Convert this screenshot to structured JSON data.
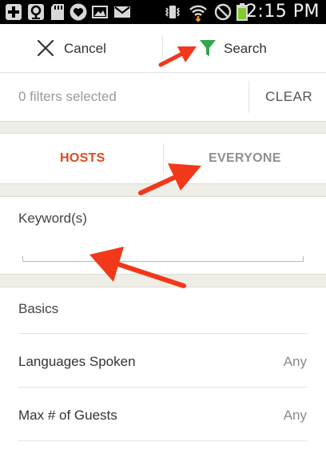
{
  "status_bar": {
    "time": "2:15 PM",
    "left_icons": [
      "plus-icon",
      "location-pin-icon",
      "sd-card-icon",
      "heart-icon",
      "image-icon",
      "gmail-icon"
    ],
    "right_icons": [
      "vibrate-icon",
      "wifi-icon",
      "no-signal-icon",
      "battery-icon"
    ]
  },
  "action_bar": {
    "cancel_label": "Cancel",
    "search_label": "Search",
    "cancel_icon": "close-icon",
    "search_icon": "filter-funnel-icon"
  },
  "filter_bar": {
    "count_text": "0 filters selected",
    "clear_label": "CLEAR"
  },
  "tabs": [
    {
      "label": "HOSTS",
      "active": true
    },
    {
      "label": "EVERYONE",
      "active": false
    }
  ],
  "keyword": {
    "label": "Keyword(s)",
    "value": ""
  },
  "basics": {
    "heading": "Basics",
    "rows": [
      {
        "label": "Languages Spoken",
        "value": "Any"
      },
      {
        "label": "Max # of Guests",
        "value": "Any"
      }
    ]
  },
  "colors": {
    "accent": "#e04a1f",
    "tab_inactive": "#8f8f8f",
    "funnel": "#2ea84a",
    "annotation_arrow": "#f2381a",
    "band": "#eeede6"
  }
}
